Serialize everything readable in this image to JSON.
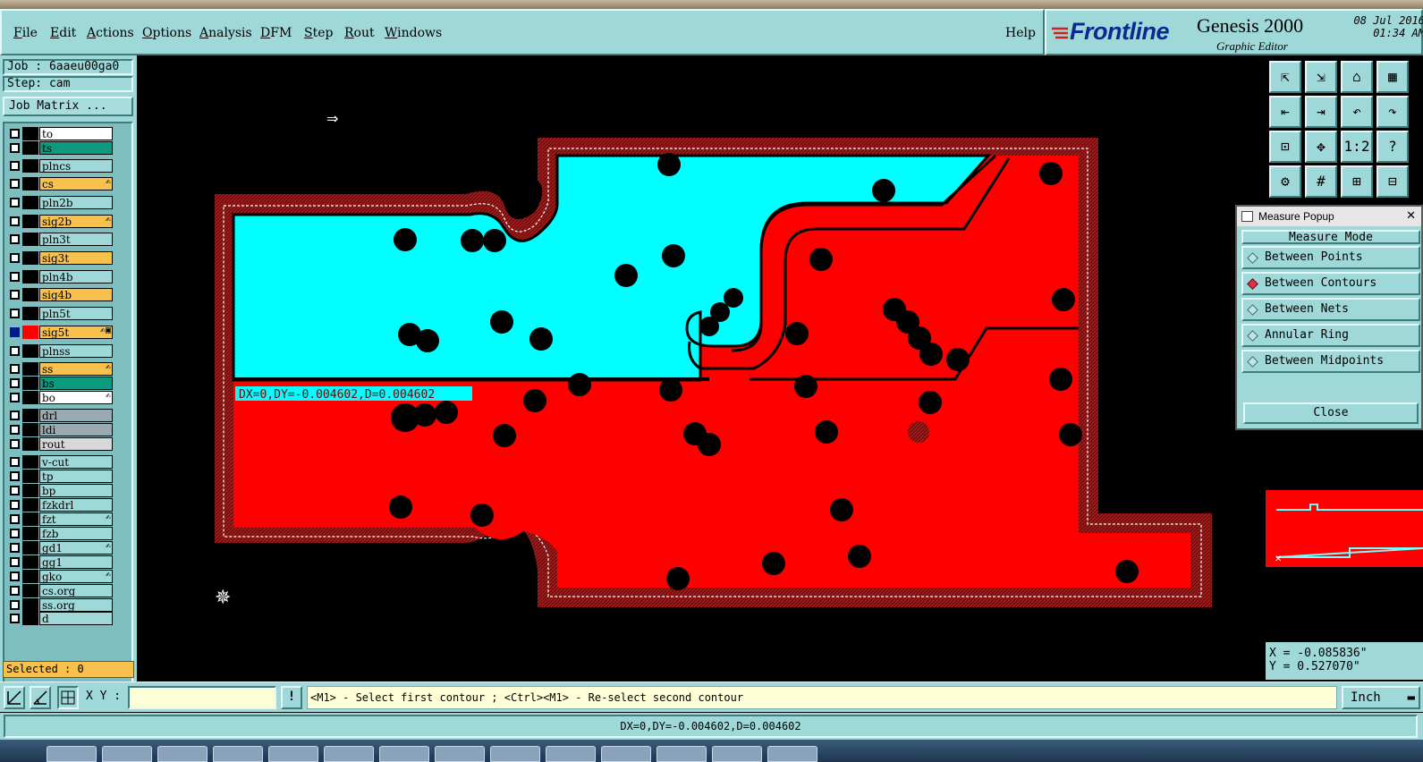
{
  "menu": {
    "items": [
      "File",
      "Edit",
      "Actions",
      "Options",
      "Analysis",
      "DFM",
      "Step",
      "Rout",
      "Windows"
    ],
    "help": "Help"
  },
  "brand": {
    "logo": "Frontline",
    "product": "Genesis 2000",
    "subtitle": "Graphic Editor",
    "date": "08 Jul 2016",
    "time": "01:34 AM"
  },
  "job": {
    "job_label": "Job : 6aaeu00ga0",
    "step_label": "Step: cam",
    "matrix_button": "Job Matrix ..."
  },
  "layers": [
    {
      "name": "to",
      "color": "#ffffff",
      "flag": ""
    },
    {
      "name": "ts",
      "color": "#0e9a7e",
      "flag": ""
    },
    {
      "name": "plncs",
      "color": "#9fd8d8",
      "flag": ""
    },
    {
      "name": "cs",
      "color": "#f8c04c",
      "flag": "✍"
    },
    {
      "name": "pln2b",
      "color": "#9fd8d8",
      "flag": ""
    },
    {
      "name": "sig2b",
      "color": "#f8c04c",
      "flag": "✍"
    },
    {
      "name": "pln3t",
      "color": "#9fd8d8",
      "flag": ""
    },
    {
      "name": "sig3t",
      "color": "#f8c04c",
      "flag": ""
    },
    {
      "name": "pln4b",
      "color": "#9fd8d8",
      "flag": ""
    },
    {
      "name": "sig4b",
      "color": "#f8c04c",
      "flag": ""
    },
    {
      "name": "pln5t",
      "color": "#9fd8d8",
      "flag": ""
    },
    {
      "name": "sig5t",
      "color": "#f8c04c",
      "flag": "✍▣",
      "active": true
    },
    {
      "name": "plnss",
      "color": "#9fd8d8",
      "flag": ""
    },
    {
      "name": "ss",
      "color": "#f8c04c",
      "flag": "✍"
    },
    {
      "name": "bs",
      "color": "#0e9a7e",
      "flag": ""
    },
    {
      "name": "bo",
      "color": "#ffffff",
      "flag": "✍"
    },
    {
      "name": "drl",
      "color": "#9aaab0",
      "flag": ""
    },
    {
      "name": "ldi",
      "color": "#9aaab0",
      "flag": ""
    },
    {
      "name": "rout",
      "color": "#d8d8d8",
      "flag": ""
    },
    {
      "name": "v-cut",
      "color": "#9fd8d8",
      "flag": ""
    },
    {
      "name": "tp",
      "color": "#9fd8d8",
      "flag": ""
    },
    {
      "name": "bp",
      "color": "#9fd8d8",
      "flag": ""
    },
    {
      "name": "fzkdrl",
      "color": "#9fd8d8",
      "flag": ""
    },
    {
      "name": "fzt",
      "color": "#9fd8d8",
      "flag": "✍"
    },
    {
      "name": "fzb",
      "color": "#9fd8d8",
      "flag": ""
    },
    {
      "name": "gd1",
      "color": "#9fd8d8",
      "flag": "✍"
    },
    {
      "name": "gg1",
      "color": "#9fd8d8",
      "flag": ""
    },
    {
      "name": "gko",
      "color": "#9fd8d8",
      "flag": "✍"
    },
    {
      "name": "cs.org",
      "color": "#9fd8d8",
      "flag": ""
    },
    {
      "name": "ss.org",
      "color": "#9fd8d8",
      "flag": ""
    },
    {
      "name": "d",
      "color": "#9fd8d8",
      "flag": ""
    }
  ],
  "selected": "Selected : 0",
  "canvas": {
    "measure_label": "DX=0,DY=-0.004602,D=0.004602",
    "colors": {
      "background": "#000000",
      "copper": "#ff0000",
      "highlight": "#00ffff",
      "border": "#8b1a1a"
    }
  },
  "tools": [
    "tool-home-icon",
    "tool-save-icon",
    "tool-house-icon",
    "tool-grid-icon",
    "tool-prev-icon",
    "tool-next-icon",
    "tool-undo-icon",
    "tool-redo-icon",
    "tool-zoom-fit-icon",
    "tool-zoom-home-icon",
    "tool-scale-icon",
    "tool-help-icon",
    "tool-snap-icon",
    "tool-grid2-icon",
    "tool-net-icon",
    "tool-net2-icon"
  ],
  "tool_glyphs": [
    "⇱",
    "⇲",
    "⌂",
    "▦",
    "⇤",
    "⇥",
    "↶",
    "↷",
    "⊡",
    "✥",
    "1:2",
    "?",
    "⚙",
    "#",
    "⊞",
    "⊟"
  ],
  "popup": {
    "title": "Measure Popup",
    "mode_label": "Measure Mode",
    "options": [
      {
        "label": "Between Points",
        "selected": false
      },
      {
        "label": "Between Contours",
        "selected": true
      },
      {
        "label": "Between Nets",
        "selected": false
      },
      {
        "label": "Annular Ring",
        "selected": false
      },
      {
        "label": "Between Midpoints",
        "selected": false
      }
    ],
    "close_label": "Close"
  },
  "readout": {
    "x": "X = -0.085836\"",
    "y": "Y = 0.527070\""
  },
  "bottom": {
    "xy_label": "X Y :",
    "xy_value": "",
    "exclaim": "!",
    "prompt": "<M1> - Select first contour ; <Ctrl><M1> - Re-select second contour",
    "unit": "Inch"
  },
  "status": "DX=0,DY=-0.004602,D=0.004602"
}
